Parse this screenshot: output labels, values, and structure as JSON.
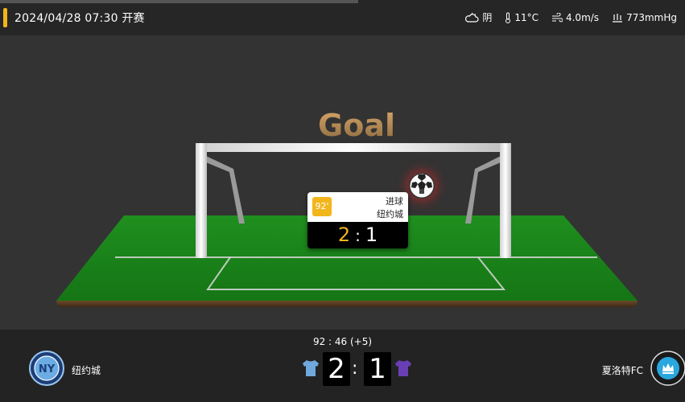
{
  "header": {
    "start_time": "2024/04/28 07:30 开赛",
    "weather": {
      "condition": "阴",
      "temperature": "11°C",
      "wind": "4.0m/s",
      "pressure": "773mmHg"
    }
  },
  "stage": {
    "goal_text": "Goal",
    "event": {
      "minute": "92'",
      "type": "进球",
      "team": "纽约城",
      "home_score": "2",
      "away_score": "1",
      "separator": ":"
    }
  },
  "scorebar": {
    "clock": "92 : 46  (+5)",
    "home": {
      "name": "纽约城",
      "score": "2",
      "shirt_color": "#6fa8dc",
      "logo_color": "#5b9bd5"
    },
    "away": {
      "name": "夏洛特FC",
      "score": "1",
      "shirt_color": "#6a3fb5",
      "logo_color": "#2aa7df"
    },
    "separator": ":"
  },
  "colors": {
    "accent": "#f2b51c",
    "pitch": "#1d8a1d"
  }
}
